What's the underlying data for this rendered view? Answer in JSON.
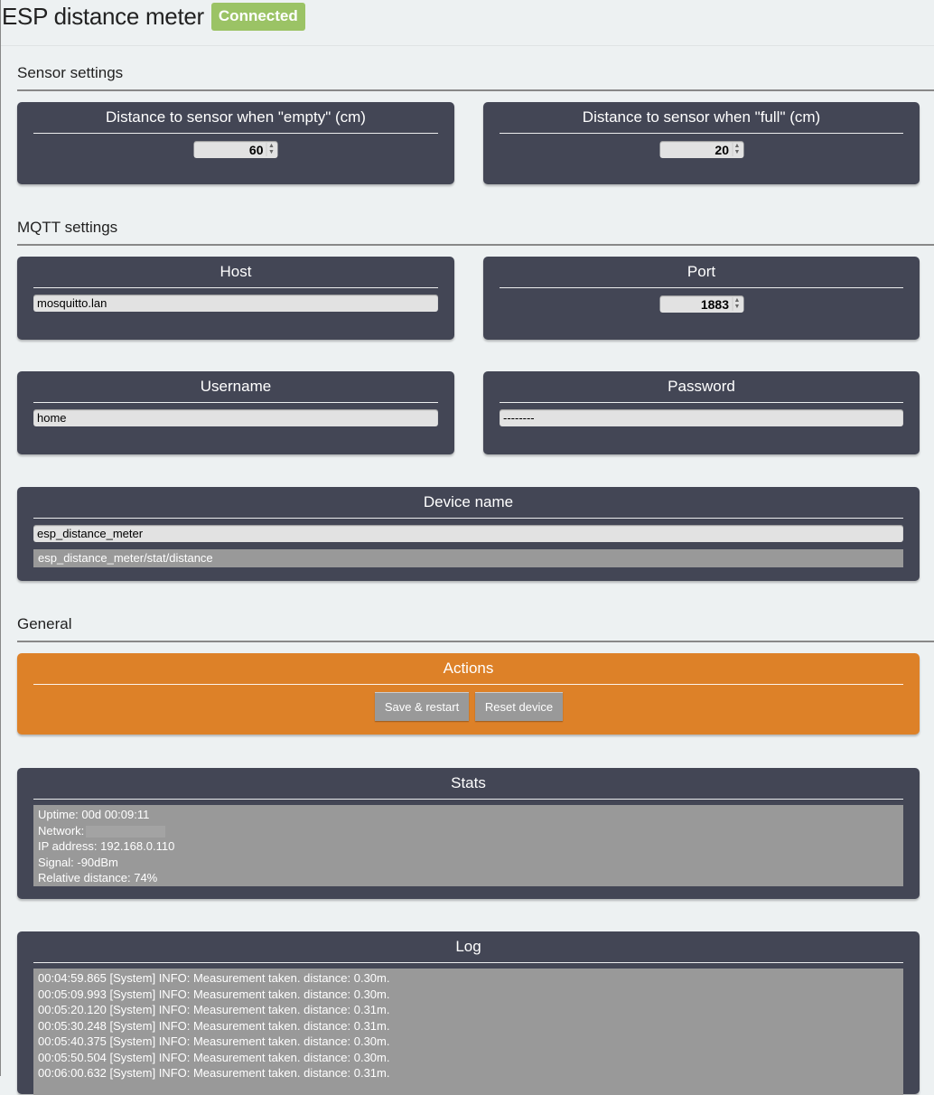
{
  "header": {
    "title": "ESP distance meter",
    "status": "Connected"
  },
  "sections": {
    "sensor": "Sensor settings",
    "mqtt": "MQTT settings",
    "general": "General"
  },
  "sensor": {
    "empty_label": "Distance to sensor when \"empty\" (cm)",
    "empty_value": "60",
    "full_label": "Distance to sensor when \"full\" (cm)",
    "full_value": "20"
  },
  "mqtt": {
    "host_label": "Host",
    "host_value": "mosquitto.lan",
    "port_label": "Port",
    "port_value": "1883",
    "username_label": "Username",
    "username_value": "home",
    "password_label": "Password",
    "password_value": "--------"
  },
  "device": {
    "label": "Device name",
    "name_value": "esp_distance_meter",
    "topic": "esp_distance_meter/stat/distance"
  },
  "actions": {
    "label": "Actions",
    "save_restart": "Save & restart",
    "reset_device": "Reset device"
  },
  "stats": {
    "label": "Stats",
    "lines": [
      "Uptime: 00d 00:09:11",
      "Network:",
      "IP address: 192.168.0.110",
      "Signal: -90dBm",
      "Relative distance: 74%"
    ]
  },
  "log": {
    "label": "Log",
    "lines": [
      "00:04:59.865 [System] INFO: Measurement taken. distance: 0.30m.",
      "00:05:09.993 [System] INFO: Measurement taken. distance: 0.30m.",
      "00:05:20.120 [System] INFO: Measurement taken. distance: 0.31m.",
      "00:05:30.248 [System] INFO: Measurement taken. distance: 0.31m.",
      "00:05:40.375 [System] INFO: Measurement taken. distance: 0.30m.",
      "00:05:50.504 [System] INFO: Measurement taken. distance: 0.30m.",
      "00:06:00.632 [System] INFO: Measurement taken. distance: 0.31m."
    ]
  },
  "colors": {
    "card": "#434655",
    "accent": "#dd8128",
    "badge": "#9bc365",
    "background": "#edf1f2"
  }
}
